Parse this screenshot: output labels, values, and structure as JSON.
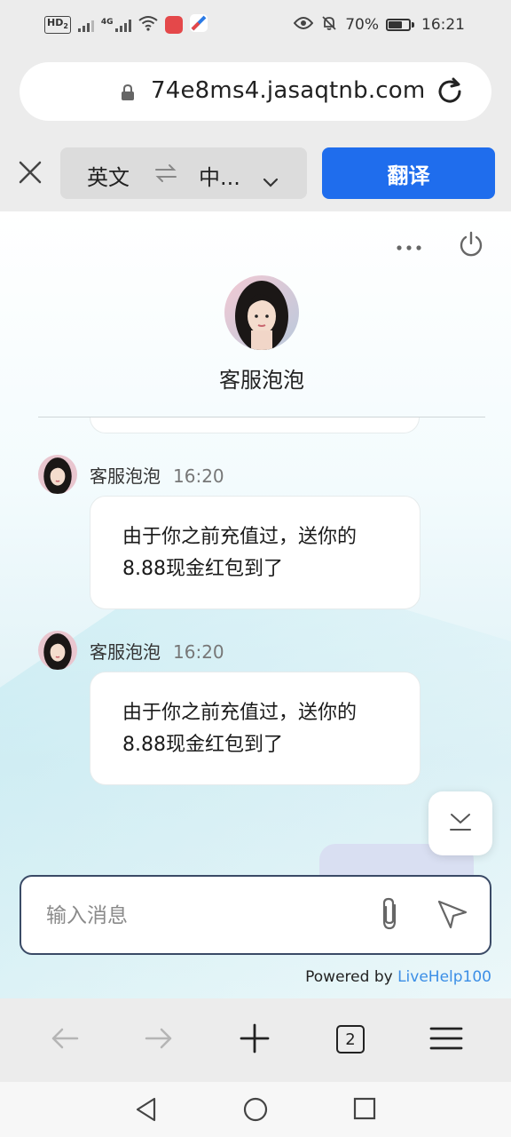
{
  "status_bar": {
    "network_chip": "HD",
    "network_sub": "2",
    "network_type": "4G",
    "battery_percent": "70%",
    "battery_level": 0.7,
    "time": "16:21",
    "icons": [
      "hd-icon",
      "signal-x-icon",
      "signal-4g-icon",
      "wifi-icon",
      "app-badge-icon",
      "flight-app-icon",
      "eye-icon",
      "mute-bell-icon",
      "battery-icon"
    ]
  },
  "browser": {
    "url": "74e8ms4.jasaqtnb.com",
    "icons": [
      "lock-icon",
      "reload-icon"
    ]
  },
  "translate_bar": {
    "source_lang": "英文",
    "target_lang": "中...",
    "translate_label": "翻译",
    "icons": [
      "close-icon",
      "swap-icon",
      "chevron-down-icon"
    ]
  },
  "chat": {
    "agent_name": "客服泡泡",
    "messages": [
      {
        "sender": "客服泡泡",
        "time": "16:20",
        "text_line1": "由于你之前充值过，送你的",
        "text_line2": "8.88现金红包到了"
      },
      {
        "sender": "客服泡泡",
        "time": "16:20",
        "text_line1": "由于你之前充值过，送你的",
        "text_line2": "8.88现金红包到了"
      }
    ],
    "input_placeholder": "输入消息",
    "powered_prefix": "Powered by",
    "powered_brand": "LiveHelp100",
    "icons": [
      "more-icon",
      "power-icon",
      "scroll-down-icon",
      "attach-icon",
      "send-icon"
    ]
  },
  "browser_toolbar": {
    "tab_count": "2",
    "icons": [
      "back-arrow-icon",
      "forward-arrow-icon",
      "new-tab-plus-icon",
      "tabs-icon",
      "menu-icon"
    ]
  },
  "nav_bar": {
    "icons": [
      "nav-back-icon",
      "nav-home-icon",
      "nav-recents-icon"
    ]
  },
  "colors": {
    "accent": "#1f6ded",
    "brand_link": "#3b8ee6",
    "chrome_bg": "#ececec"
  }
}
